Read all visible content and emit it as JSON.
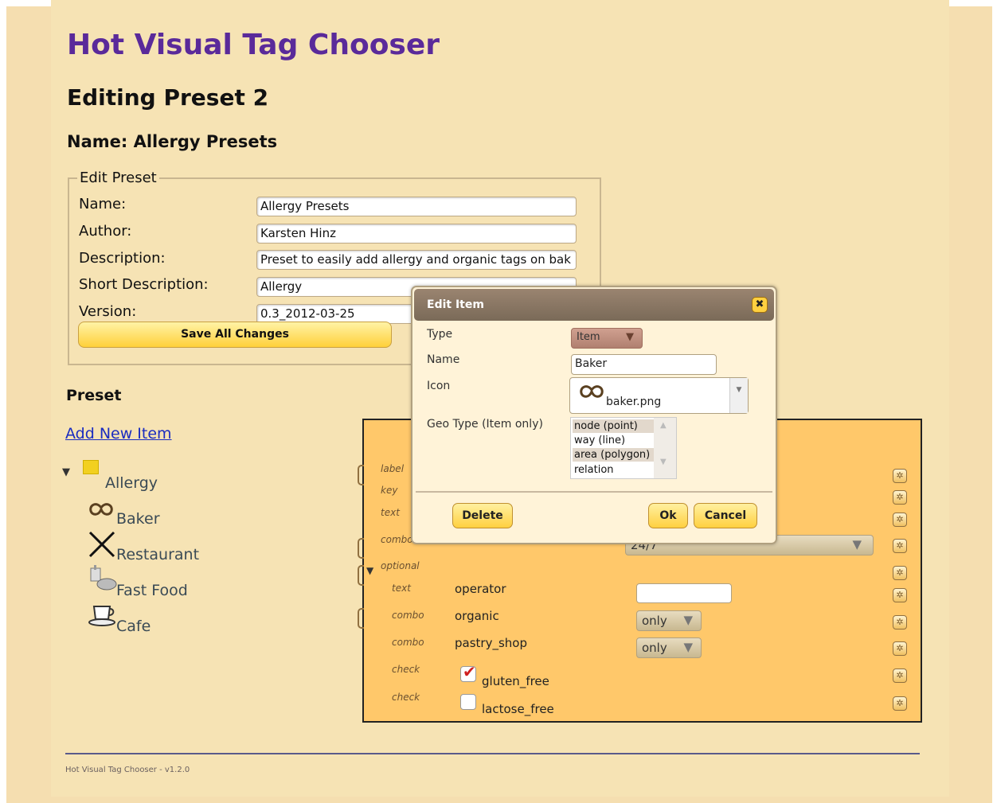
{
  "page": {
    "title": "Hot Visual Tag Chooser",
    "editing_heading": "Editing Preset 2",
    "name_heading": "Name: Allergy Presets"
  },
  "edit_preset": {
    "legend": "Edit Preset",
    "fields": [
      {
        "label": "Name:",
        "value": "Allergy Presets"
      },
      {
        "label": "Author:",
        "value": "Karsten Hinz"
      },
      {
        "label": "Description:",
        "value": "Preset to easily add allergy and organic tags on bak"
      },
      {
        "label": "Short Description:",
        "value": "Allergy"
      },
      {
        "label": "Version:",
        "value": "0.3_2012-03-25"
      }
    ],
    "save_label": "Save All Changes"
  },
  "preset": {
    "heading": "Preset",
    "add_link": "Add New Item",
    "group": "Allergy",
    "items": [
      "Baker",
      "Restaurant",
      "Fast Food",
      "Cafe"
    ]
  },
  "detail": {
    "rows": [
      {
        "type": "label",
        "key": "",
        "value": ""
      },
      {
        "type": "key",
        "key": "",
        "value": ""
      },
      {
        "type": "text",
        "key": "",
        "value": ""
      },
      {
        "type": "combo",
        "key": "",
        "value": "24/7"
      },
      {
        "type": "optional",
        "key": "",
        "value": ""
      },
      {
        "type": "text",
        "key": "operator",
        "value": ""
      },
      {
        "type": "combo",
        "key": "organic",
        "value": "only"
      },
      {
        "type": "combo",
        "key": "pastry_shop",
        "value": "only"
      },
      {
        "type": "check",
        "key": "gluten_free",
        "checked": true
      },
      {
        "type": "check",
        "key": "lactose_free",
        "checked": false
      }
    ]
  },
  "dialog": {
    "title": "Edit Item",
    "type_label": "Type",
    "type_value": "Item",
    "name_label": "Name",
    "name_value": "Baker",
    "icon_label": "Icon",
    "icon_value": "baker.png",
    "geo_label": "Geo Type (Item only)",
    "geo_options": [
      "node (point)",
      "way (line)",
      "area (polygon)",
      "relation"
    ],
    "delete_label": "Delete",
    "ok_label": "Ok",
    "cancel_label": "Cancel"
  },
  "footer": {
    "text": "Hot Visual Tag Chooser - v1.2.0"
  },
  "colors": {
    "title": "#5a2a9a",
    "panel": "#ffc86a",
    "background": "#f6e3b4",
    "link": "#1a2cc0",
    "button": "#ffd040"
  }
}
